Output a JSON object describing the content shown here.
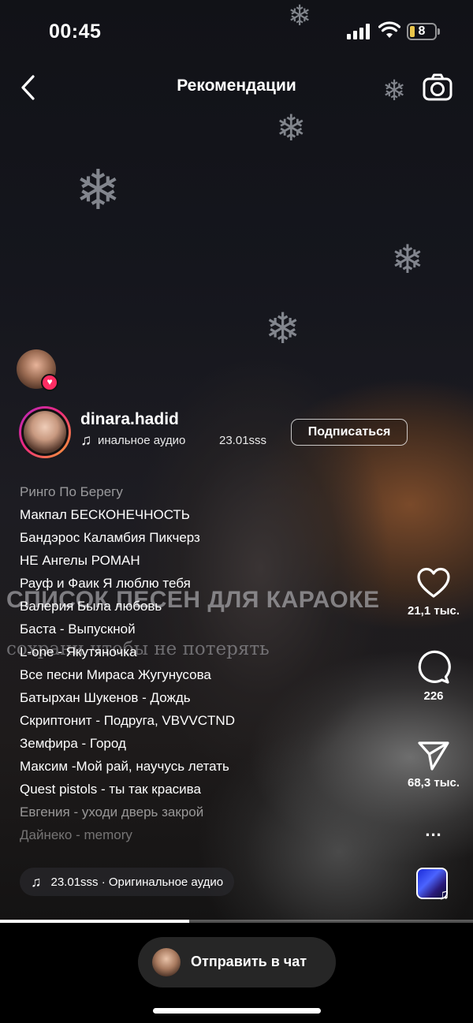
{
  "status_bar": {
    "time": "00:45",
    "battery_level": "8",
    "battery_color": "#e9c54a"
  },
  "header": {
    "title": "Рекомендации",
    "back_icon": "chevron-left-icon",
    "camera_icon": "camera-icon"
  },
  "author": {
    "username": "dinara.hadid",
    "audio_text": "инальное аудио",
    "audio_user": "23.01sss",
    "follow_label": "Подписаться"
  },
  "overlay": {
    "title": "СПИСОК ПЕСЕН ДЛЯ КАРАОКЕ",
    "subtitle": "сохрани чтобы не потерять"
  },
  "songs": [
    "Ринго По Берегу",
    "Макпал БЕСКОНЕЧНОСТЬ",
    "Бандэрос Каламбия Пикчерз",
    "НЕ Ангелы РОМАН",
    "Рауф и Фаик Я люблю тебя",
    "Валерия Была любовь",
    "Баста - Выпускной",
    "L-one - Якутяночка",
    "Все песни Мираса Жугунусова",
    "Батырхан Шукенов - Дождь",
    "Скриптонит - Подруга, VBVVCTND",
    "Земфира - Город",
    "Максим -Мой рай, научусь летать",
    "Quest pistols - ты так красива",
    "Евгения - уходи дверь закрой",
    "Дайнеко - memory"
  ],
  "actions": {
    "likes": "21,1 тыс.",
    "comments": "226",
    "shares": "68,3 тыс.",
    "more": "..."
  },
  "audio_pill": {
    "text": "23.01sss · Оригинальное аудио"
  },
  "progress": {
    "fraction": 0.4
  },
  "bottom": {
    "chat_label": "Отправить в чат"
  }
}
